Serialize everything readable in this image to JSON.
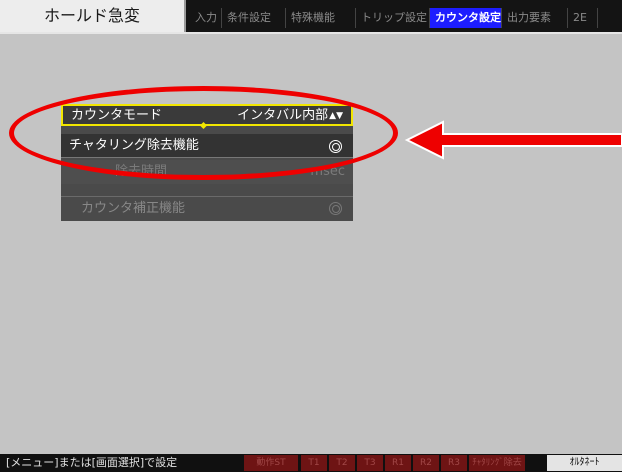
{
  "header": {
    "title": "ホールド急変",
    "tabs": [
      {
        "label": "入力",
        "active": false
      },
      {
        "label": "条件設定",
        "active": false
      },
      {
        "label": "特殊機能",
        "active": false
      },
      {
        "label": "トリップ設定",
        "active": false
      },
      {
        "label": "カウンタ設定",
        "active": true
      },
      {
        "label": "出力要素",
        "active": false
      },
      {
        "label": "2E",
        "active": false
      }
    ]
  },
  "menu": {
    "counter_mode": {
      "label": "カウンタモード",
      "value": "インタバル内部",
      "arrows": "▲▼"
    },
    "chattering": {
      "label": "チャタリング除去機能"
    },
    "removal_time": {
      "label": "除去時間",
      "unit": "msec"
    },
    "correction": {
      "label": "カウンタ補正機能"
    }
  },
  "icons": {
    "selected": "double-circle-icon",
    "arrow": "left-arrow-icon"
  },
  "colors": {
    "active_tab": "#1d1dff",
    "focus_border": "#f2e600",
    "annotation": "#ee0000",
    "status_box": "#6e1414"
  },
  "footer": {
    "hint": "[メニュー]または[画面選択]で設定",
    "status_boxes": [
      "動作ST",
      "T1",
      "T2",
      "T3",
      "R1",
      "R2",
      "R3",
      "ﾁｬﾀﾘﾝｸﾞ除去"
    ],
    "alternate": "ｵﾙﾀﾈｰﾄ"
  }
}
